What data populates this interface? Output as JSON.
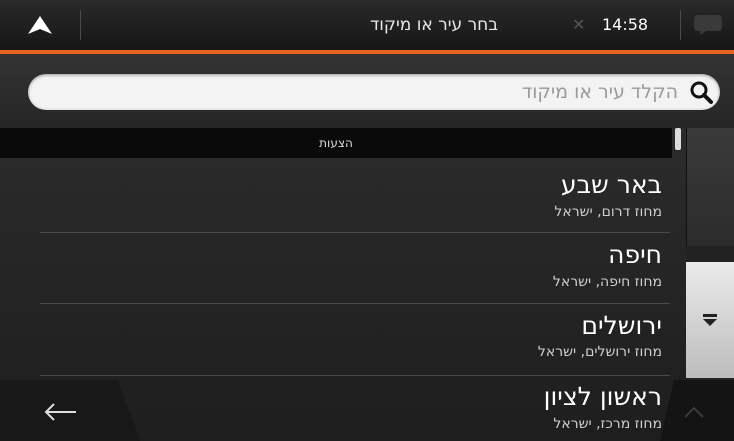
{
  "header": {
    "title": "בחר עיר או מיקוד",
    "time": "14:58",
    "nav_icon": "navigation-arrow-icon",
    "message_icon": "message-bubble-icon"
  },
  "search": {
    "placeholder": "הקלד עיר או מיקוד",
    "value": ""
  },
  "list": {
    "section_header": "הצעות",
    "items": [
      {
        "name": "באר שבע",
        "region": "מחוז דרום, ישראל"
      },
      {
        "name": "חיפה",
        "region": "מחוז חיפה, ישראל"
      },
      {
        "name": "ירושלים",
        "region": "מחוז ירושלים, ישראל"
      },
      {
        "name": "ראשון לציון",
        "region": "מחוז מרכז, ישראל"
      }
    ]
  },
  "colors": {
    "accent": "#e8651f",
    "background": "#1a1a1a"
  }
}
